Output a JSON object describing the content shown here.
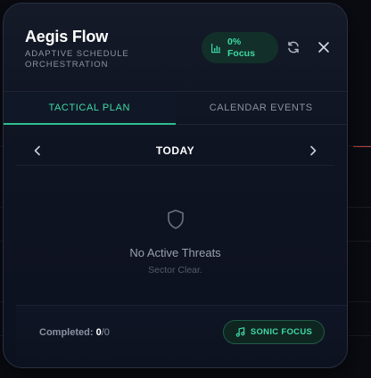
{
  "app": {
    "title": "Aegis Flow",
    "subtitle": "ADAPTIVE SCHEDULE ORCHESTRATION"
  },
  "focus": {
    "value": "0%",
    "label": "Focus",
    "icon": "bar-chart-icon"
  },
  "header_actions": {
    "refresh_icon": "refresh-icon",
    "close_icon": "close-icon"
  },
  "tabs": [
    {
      "label": "TACTICAL PLAN",
      "active": true
    },
    {
      "label": "CALENDAR EVENTS",
      "active": false
    }
  ],
  "day_nav": {
    "label": "TODAY",
    "prev_icon": "chevron-left-icon",
    "next_icon": "chevron-right-icon"
  },
  "empty_state": {
    "icon": "shield-icon",
    "title": "No Active Threats",
    "subtitle": "Sector Clear."
  },
  "footer": {
    "completed_label": "Completed:",
    "completed_count": "0",
    "total_count": "/0",
    "sonic_label": "SONIC FOCUS",
    "sonic_icon": "music-note-icon"
  },
  "colors": {
    "accent": "#3ed9a3",
    "panel_bg": "#0f1422",
    "alert_line": "#c0453b"
  }
}
